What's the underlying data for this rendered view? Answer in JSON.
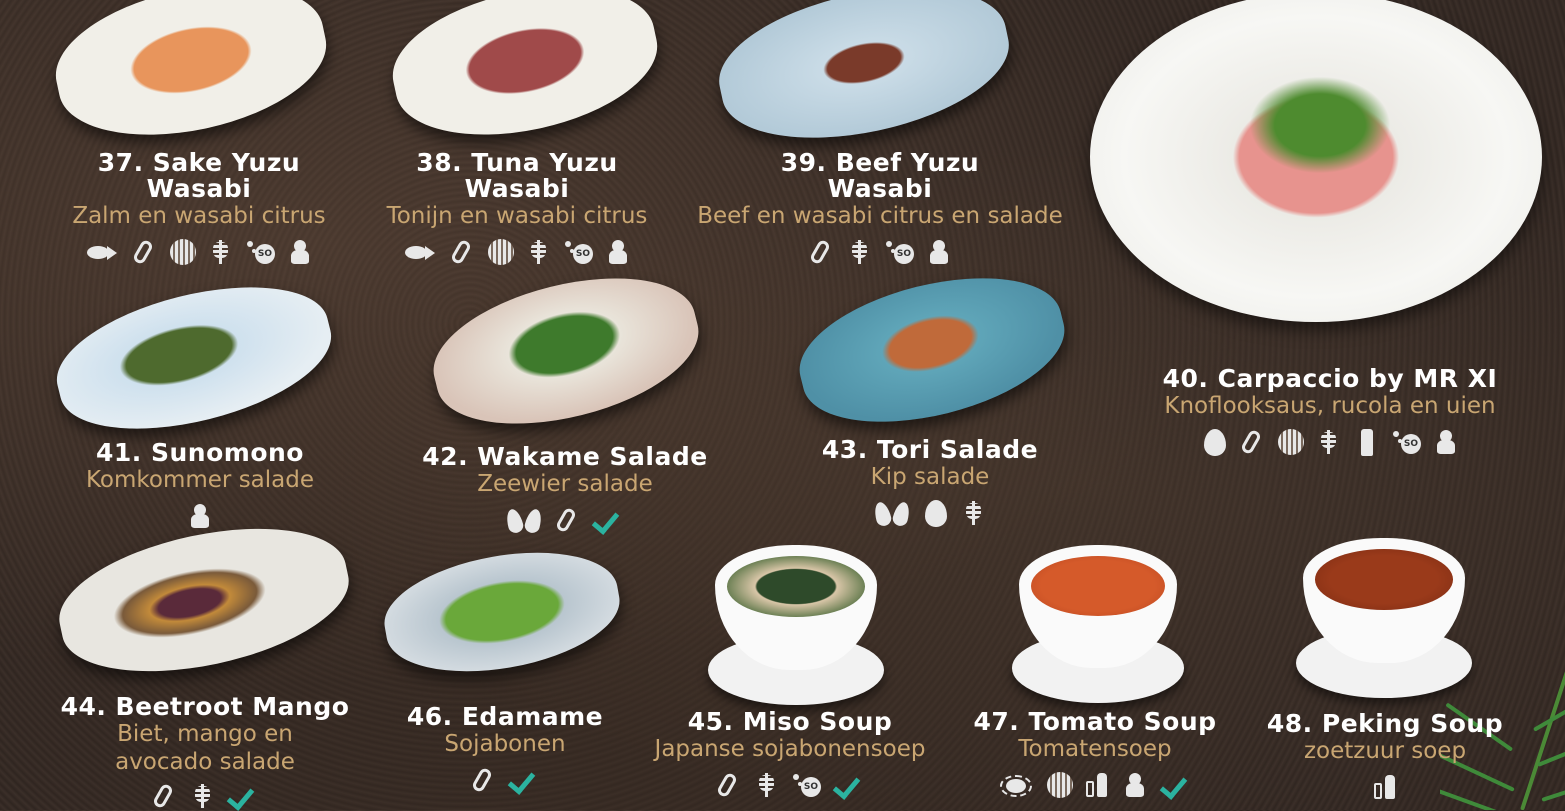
{
  "dishes": [
    {
      "name": "37. Sake Yuzu Wasabi",
      "desc": "Zalm en wasabi citrus",
      "icons": [
        "fish-icon",
        "soy-icon",
        "nut-icon",
        "wheat-icon",
        "sesame-icon",
        "celery-icon"
      ]
    },
    {
      "name": "38. Tuna Yuzu Wasabi",
      "desc": "Tonijn en wasabi citrus",
      "icons": [
        "fish-icon",
        "soy-icon",
        "nut-icon",
        "wheat-icon",
        "sesame-icon",
        "celery-icon"
      ]
    },
    {
      "name": "39. Beef Yuzu Wasabi",
      "desc": "Beef en wasabi citrus en salade",
      "icons": [
        "soy-icon",
        "wheat-icon",
        "sesame-icon",
        "celery-icon"
      ]
    },
    {
      "name": "40. Carpaccio by MR XI",
      "desc": "Knoflooksaus, rucola en uien",
      "icons": [
        "egg-icon",
        "soy-icon",
        "nut-icon",
        "wheat-icon",
        "milk-icon",
        "sesame-icon",
        "celery-icon"
      ]
    },
    {
      "name": "41. Sunomono",
      "desc": "Komkommer salade",
      "icons": [
        "celery-icon"
      ]
    },
    {
      "name": "42. Wakame Salade",
      "desc": "Zeewier salade",
      "icons": [
        "lupin-icon",
        "soy-icon",
        "vegan-check-icon"
      ]
    },
    {
      "name": "43. Tori Salade",
      "desc": "Kip salade",
      "icons": [
        "lupin-icon",
        "egg-icon",
        "wheat-icon"
      ]
    },
    {
      "name": "44. Beetroot Mango",
      "desc1": "Biet, mango en",
      "desc2": "avocado salade",
      "icons": [
        "soy-icon",
        "wheat-icon",
        "vegan-check-icon"
      ]
    },
    {
      "name": "46. Edamame",
      "desc": "Sojabonen",
      "icons": [
        "soy-icon",
        "vegan-check-icon"
      ]
    },
    {
      "name": "45. Miso Soup",
      "desc": "Japanse sojabonensoep",
      "icons": [
        "soy-icon",
        "wheat-icon",
        "sesame-icon",
        "vegan-check-icon"
      ]
    },
    {
      "name": "47. Tomato Soup",
      "desc": "Tomatensoep",
      "icons": [
        "crab-icon",
        "nut-icon",
        "bottle-icon",
        "celery-icon",
        "vegan-check-icon"
      ]
    },
    {
      "name": "48. Peking Soup",
      "desc": "zoetzuur soep",
      "icons": [
        "bottle-icon"
      ]
    }
  ],
  "name_lines": {
    "d37": [
      "37. Sake Yuzu",
      "Wasabi"
    ],
    "d38": [
      "38. Tuna Yuzu",
      "Wasabi"
    ],
    "d39": [
      "39. Beef Yuzu",
      "Wasabi"
    ]
  },
  "colors": {
    "name": "#ffffff",
    "desc": "#c9a672",
    "vegan_check": "#2bb3a0"
  }
}
